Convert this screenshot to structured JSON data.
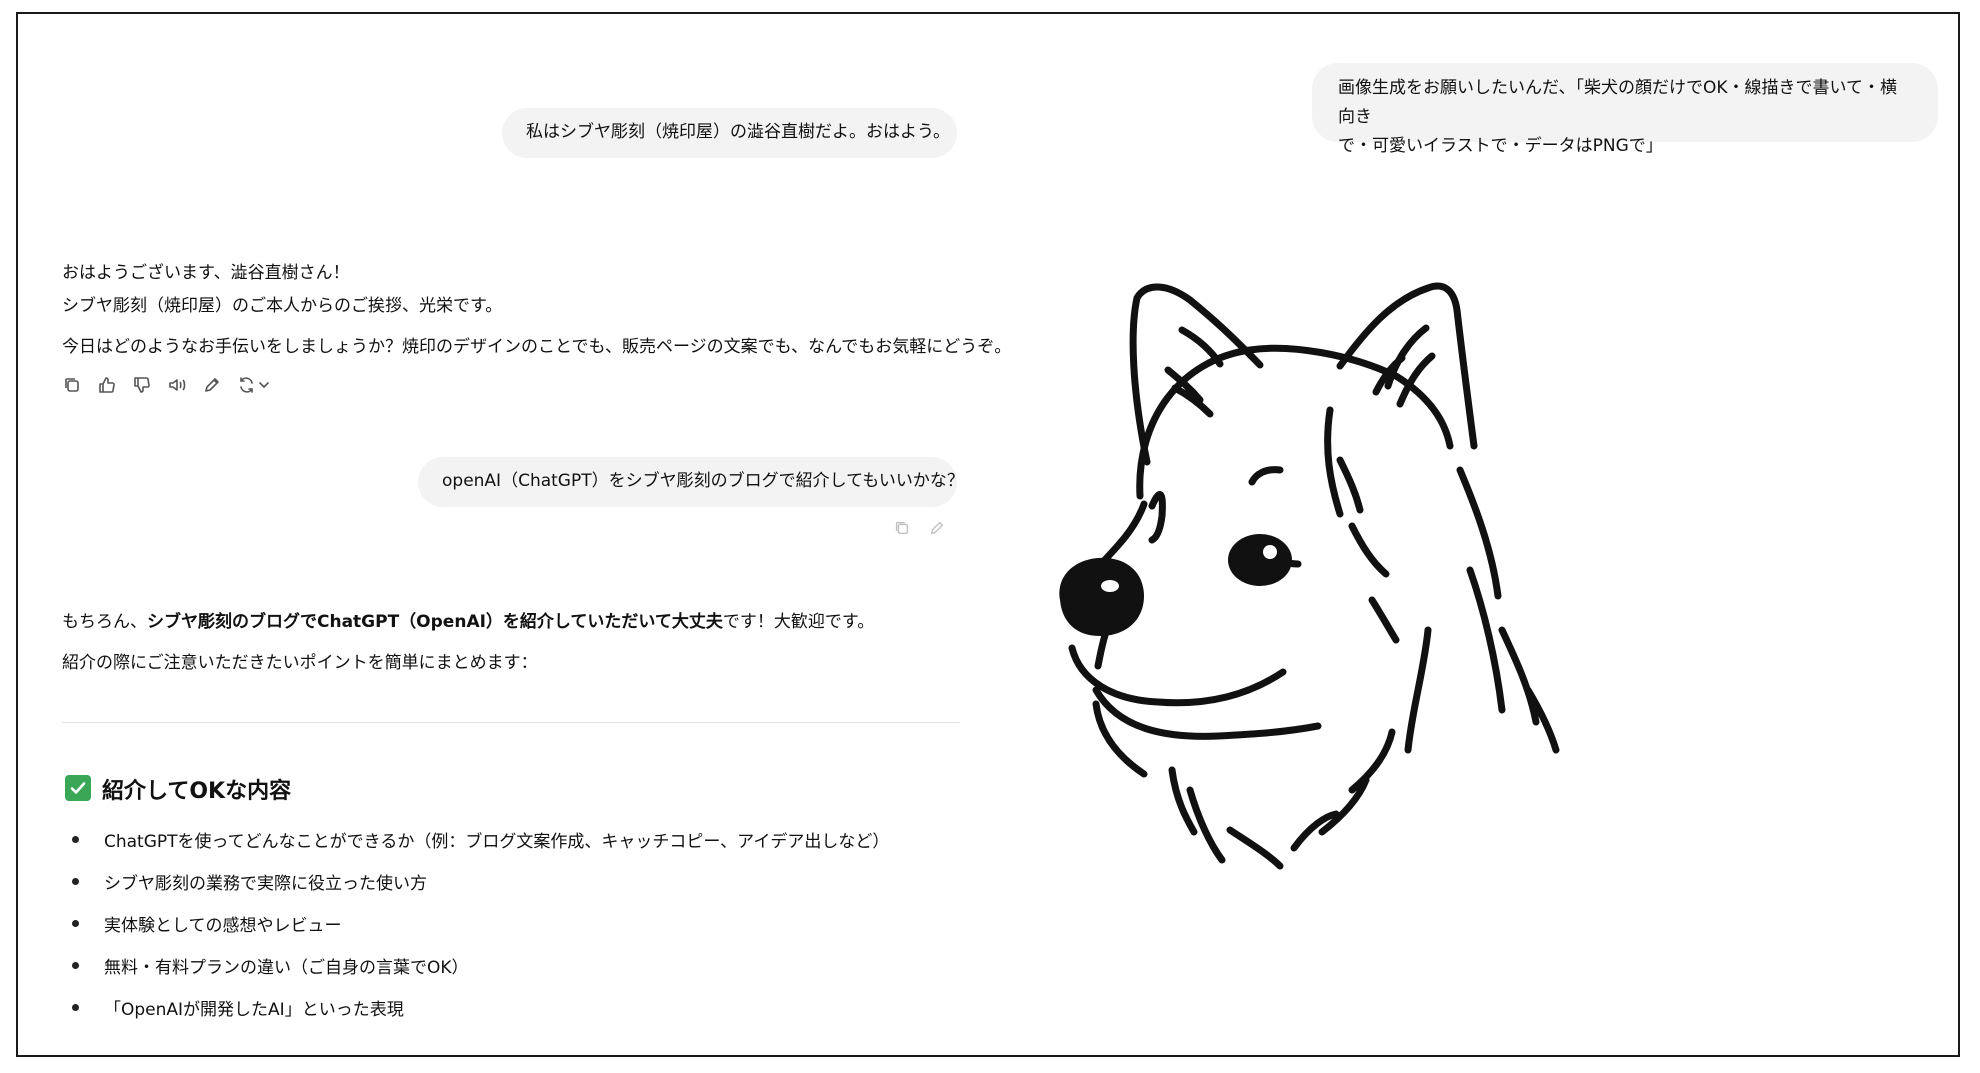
{
  "user_messages": {
    "image_request_line1": "画像生成をお願いしたいんだ、「柴犬の顔だけでOK・線描きで書いて・横向き",
    "image_request_line2": "で・可愛いイラストで・データはPNGで」",
    "greeting": "私はシブヤ彫刻（焼印屋）の澁谷直樹だよ。おはよう。",
    "blog_question": "openAI（ChatGPT）をシブヤ彫刻のブログで紹介してもいいかな？"
  },
  "assistant_reply_1": {
    "line1": "おはようございます、澁谷直樹さん！",
    "line2": "シブヤ彫刻（焼印屋）のご本人からのご挨拶、光栄です。",
    "line3": "今日はどのようなお手伝いをしましょうか？焼印のデザインのことでも、販売ページの文案でも、なんでもお気軽にどうぞ。"
  },
  "assistant_reply_2": {
    "intro_prefix": "もちろん、",
    "intro_bold": "シブヤ彫刻のブログでChatGPT（OpenAI）を紹介していただいて大丈夫",
    "intro_suffix": "です！大歓迎です。",
    "summary": "紹介の際にご注意いただきたいポイントを簡単にまとめます：",
    "section_heading": "紹介してOKな内容",
    "items": [
      "ChatGPTを使ってどんなことができるか（例：ブログ文案作成、キャッチコピー、アイデア出しなど）",
      "シブヤ彫刻の業務で実際に役立った使い方",
      "実体験としての感想やレビュー",
      "無料・有料プランの違い（ご自身の言葉でOK）",
      "「OpenAIが開発したAI」といった表現"
    ]
  },
  "icons": [
    "copy-icon",
    "thumbs-up-icon",
    "thumbs-down-icon",
    "read-aloud-icon",
    "edit-icon",
    "regenerate-icon",
    "check-icon"
  ],
  "colors": {
    "bubble": "#f3f3f3",
    "check": "#3aa757",
    "text": "#111111"
  }
}
